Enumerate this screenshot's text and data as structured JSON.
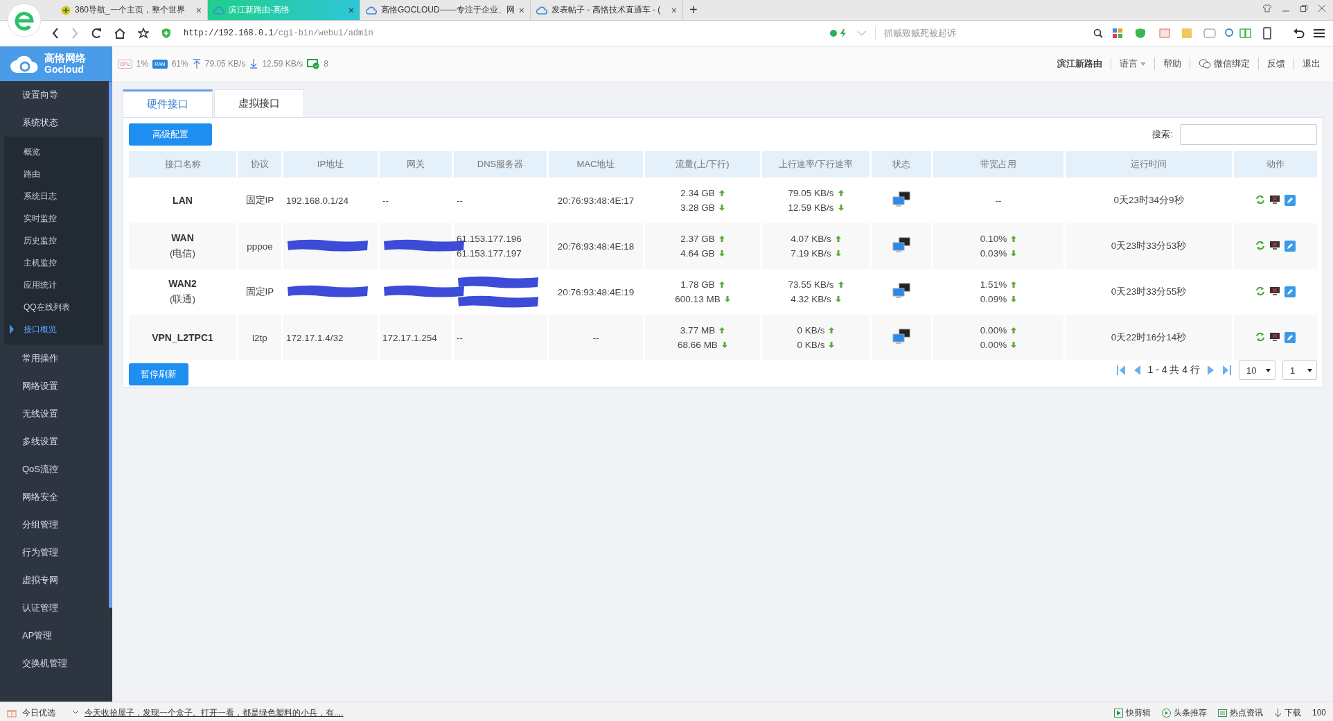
{
  "browser": {
    "tabs": [
      {
        "title": "360导航_一个主页，整个世界",
        "kind": "nav",
        "selected": false
      },
      {
        "title": "滨江新路由-高恪",
        "kind": "cloud",
        "selected": true
      },
      {
        "title": "高恪GOCLOUD——专注于企业、网",
        "kind": "cloud",
        "selected": false
      },
      {
        "title": "发表帖子 - 高恪技术直通车 - (",
        "kind": "cloud",
        "selected": false
      }
    ],
    "close_glyph": "×",
    "new_tab": "+",
    "address_host": "http://192.168.0.1",
    "address_path": "/cgi-bin/webui/admin",
    "search_placeholder": "抓贼致贼死被起诉"
  },
  "header": {
    "logo_name": "高恪网络",
    "logo_sub": "Gocloud",
    "cpu_label": "CPU",
    "cpu": "1%",
    "ram_label": "RAM",
    "ram": "61%",
    "upload": "79.05 KB/s",
    "download": "12.59 KB/s",
    "devices": "8",
    "links": [
      {
        "label": "滨江新路由",
        "kind": "bold"
      },
      {
        "label": "语言",
        "kind": "dropdown"
      },
      {
        "label": "帮助",
        "kind": "plain"
      },
      {
        "label": "微信绑定",
        "kind": "wechat"
      },
      {
        "label": "反馈",
        "kind": "plain"
      },
      {
        "label": "退出",
        "kind": "plain"
      }
    ]
  },
  "sidebar": {
    "items": [
      {
        "label": "设置向导"
      },
      {
        "label": "系统状态",
        "children": [
          {
            "label": "概览",
            "selected": false
          },
          {
            "label": "路由",
            "selected": false
          },
          {
            "label": "系统日志",
            "selected": false
          },
          {
            "label": "实时监控",
            "selected": false
          },
          {
            "label": "历史监控",
            "selected": false
          },
          {
            "label": "主机监控",
            "selected": false
          },
          {
            "label": "应用统计",
            "selected": false
          },
          {
            "label": "QQ在线列表",
            "selected": false
          },
          {
            "label": "接口概览",
            "selected": true
          }
        ]
      },
      {
        "label": "常用操作"
      },
      {
        "label": "网络设置"
      },
      {
        "label": "无线设置"
      },
      {
        "label": "多线设置"
      },
      {
        "label": "QoS流控"
      },
      {
        "label": "网络安全"
      },
      {
        "label": "分组管理"
      },
      {
        "label": "行为管理"
      },
      {
        "label": "虚拟专网"
      },
      {
        "label": "认证管理"
      },
      {
        "label": "AP管理"
      },
      {
        "label": "交换机管理"
      }
    ]
  },
  "tabs": [
    {
      "label": "硬件接口",
      "selected": true
    },
    {
      "label": "虚拟接口",
      "selected": false
    }
  ],
  "advanced_button": "高级配置",
  "search_label": "搜索:",
  "table": {
    "columns": [
      "接口名称",
      "协议",
      "IP地址",
      "网关",
      "DNS服务器",
      "MAC地址",
      "流量(上/下行)",
      "上行速率/下行速率",
      "状态",
      "带宽占用",
      "运行时间",
      "动作"
    ],
    "rows": [
      {
        "name": "LAN",
        "protocol": "固定IP",
        "ip": "192.168.0.1/24",
        "gateway": "--",
        "dns": [
          "--"
        ],
        "mac": "20:76:93:48:4E:17",
        "traffic": [
          "2.34 GB",
          "3.28 GB"
        ],
        "rate": [
          "79.05 KB/s",
          "12.59 KB/s"
        ],
        "bandwidth": [
          "--"
        ],
        "uptime": "0天23时34分9秒"
      },
      {
        "name": "WAN",
        "isp": "(电信)",
        "protocol": "pppoe",
        "ip": {
          "kind": "redacted"
        },
        "gateway": {
          "kind": "redacted"
        },
        "dns": [
          "61.153.177.196",
          "61.153.177.197"
        ],
        "mac": "20:76:93:48:4E:18",
        "traffic": [
          "2.37 GB",
          "4.64 GB"
        ],
        "rate": [
          "4.07 KB/s",
          "7.19 KB/s"
        ],
        "bandwidth": [
          "0.10%",
          "0.03%"
        ],
        "uptime": "0天23时33分53秒"
      },
      {
        "name": "WAN2",
        "isp": "(联通)",
        "protocol": "固定IP",
        "ip": {
          "kind": "redacted"
        },
        "gateway": {
          "kind": "redacted"
        },
        "dns": [
          {
            "kind": "redacted"
          },
          {
            "kind": "redacted"
          }
        ],
        "mac": "20:76:93:48:4E:19",
        "traffic": [
          "1.78 GB",
          "600.13 MB"
        ],
        "rate": [
          "73.55 KB/s",
          "4.32 KB/s"
        ],
        "bandwidth": [
          "1.51%",
          "0.09%"
        ],
        "uptime": "0天23时33分55秒"
      },
      {
        "name": "VPN_L2TPC1",
        "protocol": "l2tp",
        "ip": "172.17.1.4/32",
        "gateway": "172.17.1.254",
        "dns": [
          "--"
        ],
        "mac": "--",
        "traffic": [
          "3.77 MB",
          "68.66 MB"
        ],
        "rate": [
          "0 KB/s",
          "0 KB/s"
        ],
        "bandwidth": [
          "0.00%",
          "0.00%"
        ],
        "uptime": "0天22时16分14秒"
      }
    ]
  },
  "pause_button": "暂停刷新",
  "pagination": {
    "range": "1 - 4 共 4 行",
    "page_size": "10",
    "page": "1"
  },
  "status_bar": {
    "left_label": "今日优选",
    "news": "今天收拾屋子，发现一个盒子。打开一看，都是绿色塑料的小兵，有....",
    "items": [
      {
        "label": "快剪辑",
        "kind": "play"
      },
      {
        "label": "头条推荐",
        "kind": "circle"
      },
      {
        "label": "热点资讯",
        "kind": "news"
      },
      {
        "label": "下载",
        "kind": "download"
      }
    ],
    "zoom": "100"
  }
}
